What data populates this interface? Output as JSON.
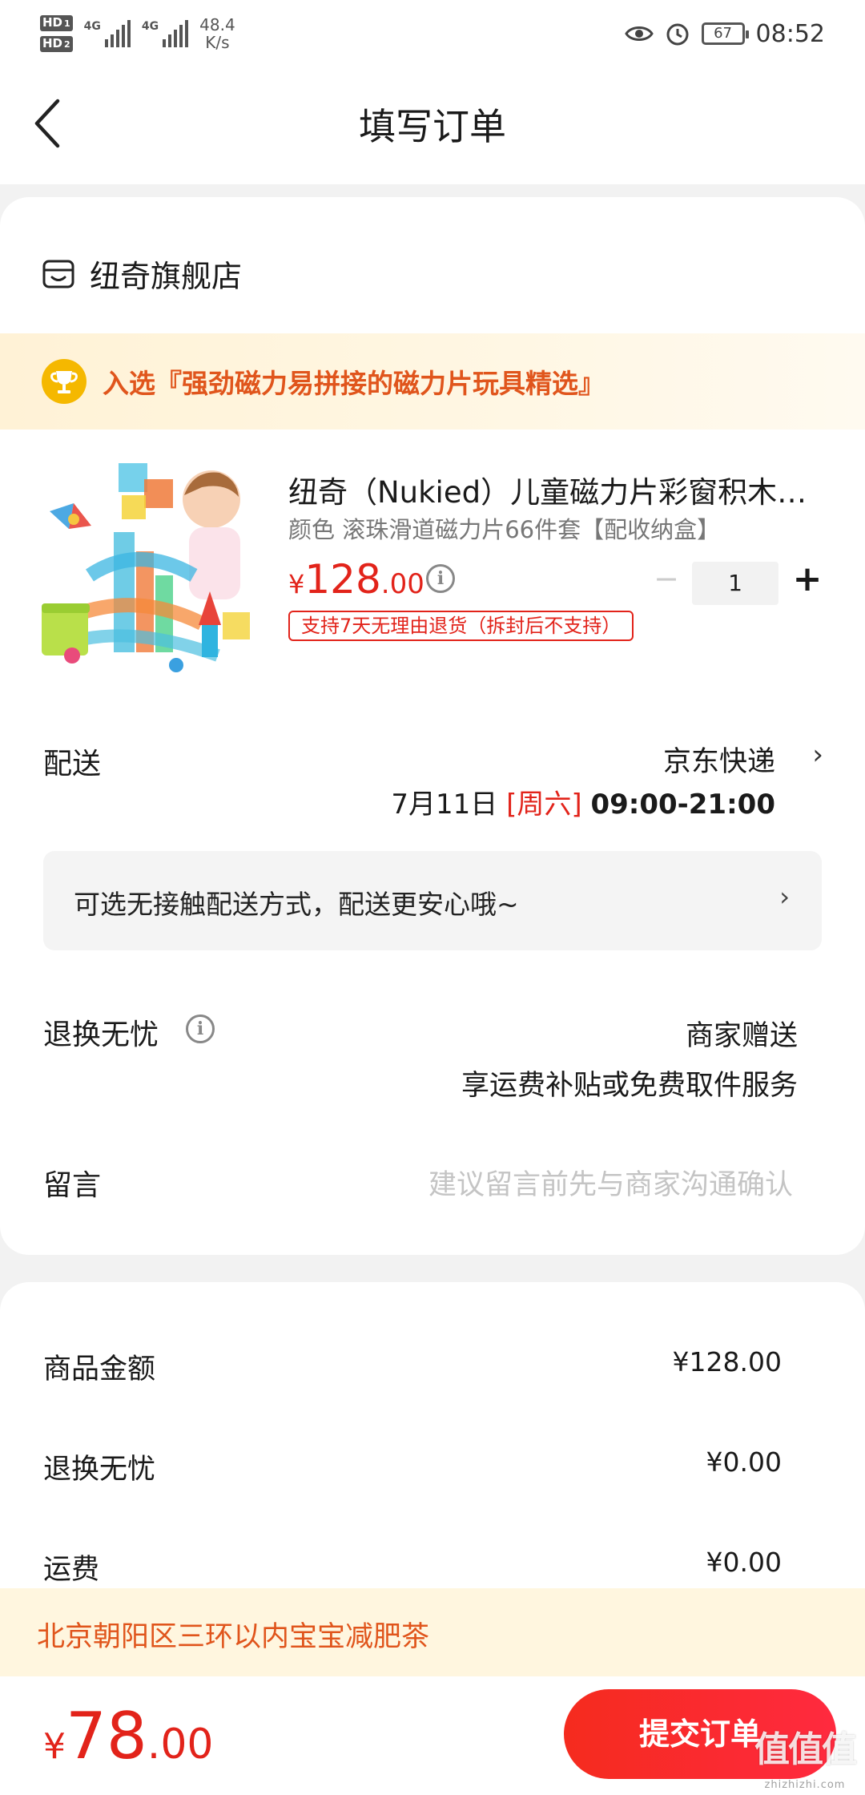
{
  "status_bar": {
    "hd1": "HD",
    "hd1_sub": "1",
    "hd2": "HD",
    "hd2_sub": "2",
    "net1": "4G",
    "net2": "4G",
    "speed_value": "48.4",
    "speed_unit": "K/s",
    "battery": "67",
    "time": "08:52",
    "icons": [
      "eye-comfort-icon",
      "alarm-icon",
      "battery-icon"
    ]
  },
  "header": {
    "back_icon": "chevron-left-icon",
    "title": "填写订单"
  },
  "store": {
    "icon": "store-icon",
    "name": "纽奇旗舰店"
  },
  "banner": {
    "icon": "trophy-icon",
    "text": "入选『强劲磁力易拼接的磁力片玩具精选』"
  },
  "product": {
    "name": "纽奇（Nukied）儿童磁力片彩窗积木…",
    "spec": "颜色 滚珠滑道磁力片66件套【配收纳盒】",
    "price_currency": "¥",
    "price_int": "128",
    "price_dec": ".00",
    "quantity": "1",
    "minus": "−",
    "plus": "+",
    "return_tag": "支持7天无理由退货（拆封后不支持）"
  },
  "delivery": {
    "label": "配送",
    "carrier": "京东快递",
    "date": "7月11日",
    "weekday": "[周六]",
    "time_range": "09:00-21:00"
  },
  "contactless": {
    "text": "可选无接触配送方式，配送更安心哦~"
  },
  "worry_free": {
    "label": "退换无忧",
    "value": "商家赠送",
    "detail": "享运费补贴或免费取件服务"
  },
  "message": {
    "label": "留言",
    "placeholder": "建议留言前先与商家沟通确认"
  },
  "summary": {
    "goods_label": "商品金额",
    "goods_value": "¥128.00",
    "worry_label": "退换无忧",
    "worry_value": "¥0.00",
    "shipping_label": "运费",
    "shipping_value": "¥0.00"
  },
  "address_bar": {
    "text": "北京朝阳区三环以内宝宝减肥茶"
  },
  "bottom": {
    "currency": "¥",
    "total_int": "78",
    "total_dec": ".00",
    "submit": "提交订单",
    "watermark": "值值值",
    "watermark_url": "zhizhizhi.com"
  },
  "colors": {
    "accent_red": "#e2231a",
    "banner_orange": "#e0551c",
    "banner_bg": "#fff2d6",
    "trophy_gold": "#f5b800"
  }
}
